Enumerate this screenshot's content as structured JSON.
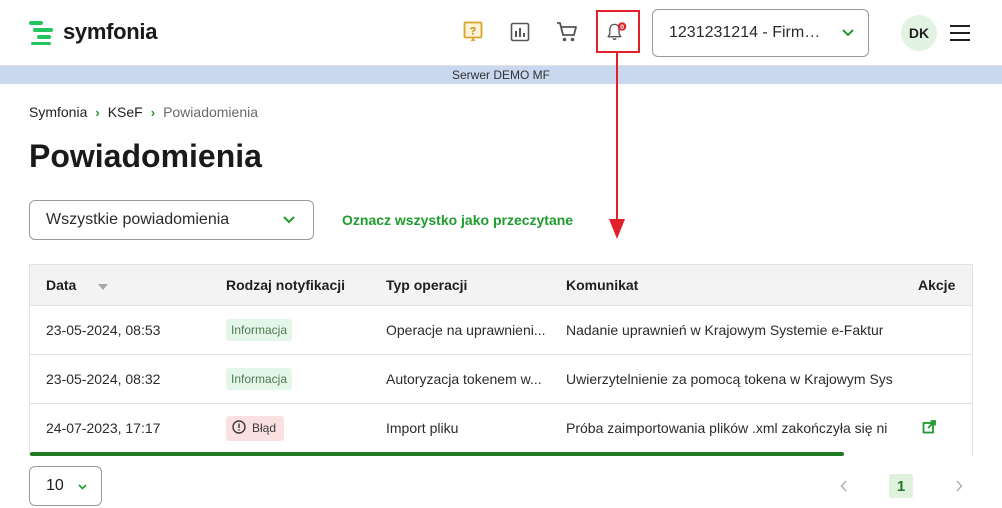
{
  "header": {
    "brand": "symfonia",
    "company": "1231231214 - Firma d...",
    "avatar_initials": "DK",
    "notification_count": "0",
    "icons": [
      "help-icon",
      "reports-icon",
      "cart-icon",
      "bell-icon",
      "menu-icon"
    ]
  },
  "server_bar": "Serwer DEMO MF",
  "breadcrumb": {
    "items": [
      "Symfonia",
      "KSeF"
    ],
    "current": "Powiadomienia"
  },
  "page_title": "Powiadomienia",
  "filter": {
    "value": "Wszystkie powiadomienia"
  },
  "mark_all_read": "Oznacz wszystko jako przeczytane",
  "table": {
    "columns": [
      "Data",
      "Rodzaj notyfikacji",
      "Typ operacji",
      "Komunikat",
      "Akcje"
    ],
    "rows": [
      {
        "date": "23-05-2024, 08:53",
        "kind": "Informacja",
        "kind_type": "info",
        "operation": "Operacje na uprawnieni...",
        "message": "Nadanie uprawnień w Krajowym Systemie e-Faktur"
      },
      {
        "date": "23-05-2024, 08:32",
        "kind": "Informacja",
        "kind_type": "info",
        "operation": "Autoryzacja tokenem w...",
        "message": "Uwierzytelnienie za pomocą tokena w Krajowym Sys"
      },
      {
        "date": "24-07-2023, 17:17",
        "kind": "Błąd",
        "kind_type": "error",
        "operation": "Import pliku",
        "message": "Próba zaimportowania plików .xml zakończyła się ni"
      }
    ]
  },
  "pagination": {
    "page_size": "10",
    "current_page": "1"
  },
  "colors": {
    "brand_green": "#1f9b2d",
    "annotation_red": "#e0202a",
    "server_bar": "#c9d7ef"
  }
}
